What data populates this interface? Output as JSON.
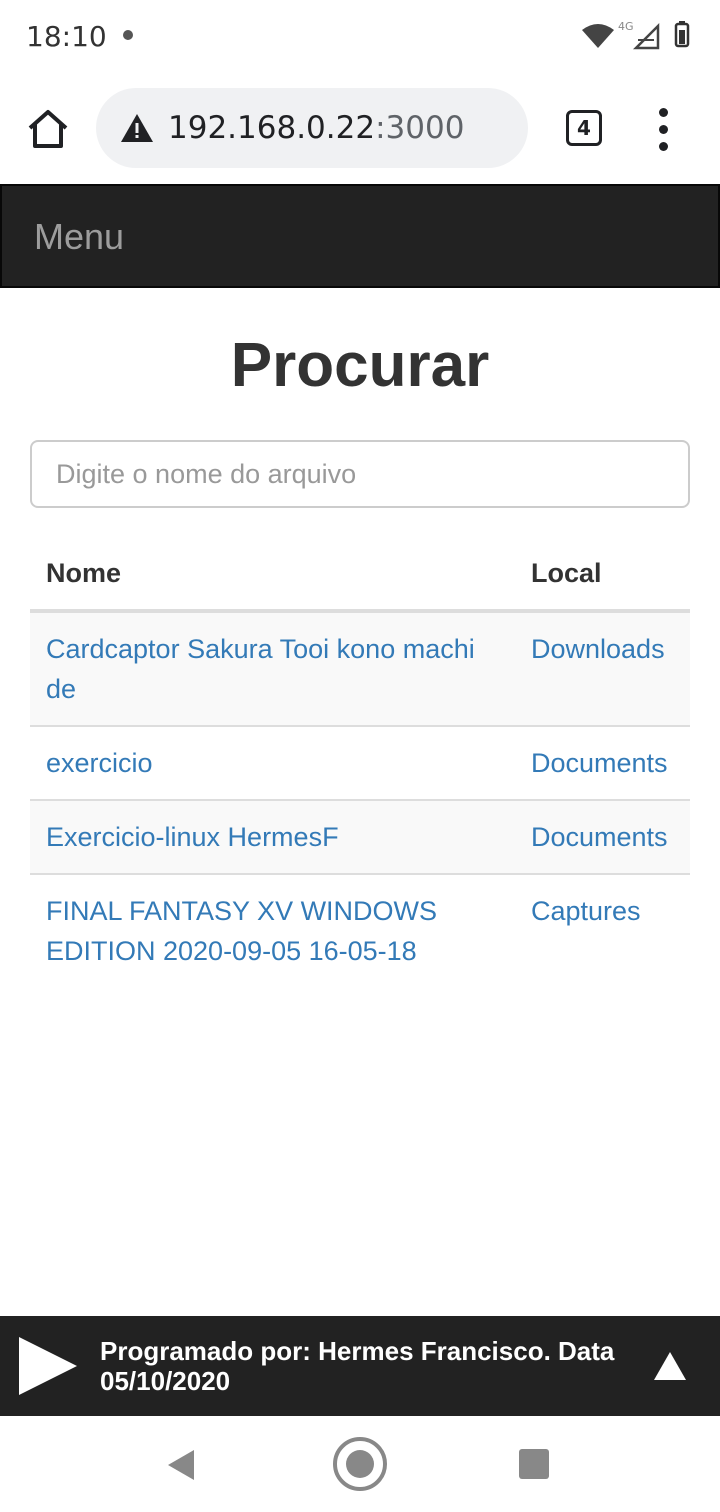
{
  "status_bar": {
    "time": "18:10",
    "network_label": "4G",
    "icons": [
      "wifi-icon",
      "cell-signal-icon",
      "battery-icon"
    ]
  },
  "browser": {
    "url_host": "192.168.0.22",
    "url_port": ":3000",
    "tab_count": "4",
    "icons": [
      "home-icon",
      "warning-icon",
      "tabs-icon",
      "more-vert-icon"
    ]
  },
  "navbar": {
    "brand": "Menu"
  },
  "main": {
    "title": "Procurar",
    "search_placeholder": "Digite o nome do arquivo",
    "search_value": ""
  },
  "table": {
    "headers": [
      "Nome",
      "Local"
    ],
    "rows": [
      {
        "name": "Cardcaptor Sakura Tooi kono machi de",
        "location": "Downloads"
      },
      {
        "name": "exercicio",
        "location": "Documents"
      },
      {
        "name": "Exercicio-linux HermesF",
        "location": "Documents"
      },
      {
        "name": "FINAL FANTASY XV WINDOWS EDITION 2020-09-05 16-05-18",
        "location": "Captures"
      }
    ]
  },
  "footer": {
    "text": "Programado por: Hermes Francisco. Data 05/10/2020",
    "icons": [
      "play-icon",
      "scroll-up-icon"
    ]
  },
  "system_nav": {
    "icons": [
      "back-icon",
      "home-circle-icon",
      "recents-icon"
    ]
  },
  "colors": {
    "navbar_bg": "#222222",
    "link": "#337ab7",
    "striped_row": "#f9f9f9",
    "url_box": "#f0f1f3"
  }
}
